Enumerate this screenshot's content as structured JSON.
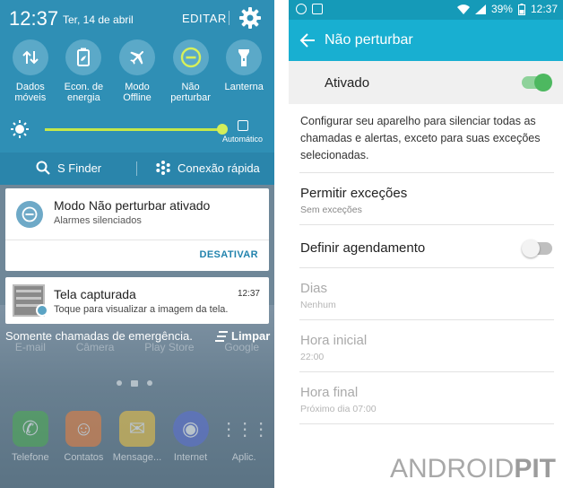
{
  "left": {
    "clock": "12:37",
    "date": "Ter, 14 de abril",
    "edit_label": "EDITAR",
    "quick_settings": [
      {
        "label": "Dados\nmóveis",
        "icon": "mobile-data-icon"
      },
      {
        "label": "Econ. de\nenergia",
        "icon": "battery-saver-icon"
      },
      {
        "label": "Modo\nOffline",
        "icon": "airplane-icon"
      },
      {
        "label": "Não\nperturbar",
        "icon": "do-not-disturb-icon"
      },
      {
        "label": "Lanterna",
        "icon": "flashlight-icon"
      }
    ],
    "brightness": {
      "level": 0.9,
      "auto_label": "Automático"
    },
    "finder_label": "S Finder",
    "quick_connect_label": "Conexão rápida",
    "notification_dnd": {
      "title": "Modo Não perturbar ativado",
      "subtitle": "Alarmes silenciados",
      "action": "DESATIVAR"
    },
    "notification_screenshot": {
      "title": "Tela capturada",
      "time": "12:37",
      "subtitle": "Toque para visualizar a imagem da tela."
    },
    "emergency_text": "Somente chamadas de emergência.",
    "clear_label": "Limpar",
    "home_apps_row": [
      "E-mail",
      "Câmera",
      "Play Store",
      "Google"
    ],
    "dock": [
      {
        "label": "Telefone",
        "icon": "phone-icon",
        "color": "#4caf50"
      },
      {
        "label": "Contatos",
        "icon": "contacts-icon",
        "color": "#f0813b"
      },
      {
        "label": "Mensage...",
        "icon": "messages-icon",
        "color": "#f5c842"
      },
      {
        "label": "Internet",
        "icon": "internet-icon",
        "color": "#5a6fd8"
      },
      {
        "label": "Aplic.",
        "icon": "apps-icon",
        "color": "#cfcfcf"
      }
    ]
  },
  "right": {
    "status": {
      "battery": "39%",
      "time": "12:37"
    },
    "title": "Não perturbar",
    "master": {
      "label": "Ativado",
      "on": true
    },
    "description": "Configurar seu aparelho para silenciar todas as chamadas e alertas, exceto para suas exceções selecionadas.",
    "exceptions": {
      "title": "Permitir exceções",
      "subtitle": "Sem exceções"
    },
    "schedule": {
      "title": "Definir agendamento",
      "on": false
    },
    "days": {
      "title": "Dias",
      "subtitle": "Nenhum"
    },
    "start": {
      "title": "Hora inicial",
      "subtitle": "22:00"
    },
    "end": {
      "title": "Hora final",
      "subtitle": "Próximo dia 07:00"
    }
  },
  "watermark": {
    "part1": "ANDROID",
    "part2": "PIT"
  },
  "colors": {
    "shade": "#2f8fb5",
    "tile": "#5ba9c8",
    "accent_blue": "#18afd1",
    "toggle_on": "#4db860",
    "slider": "#c5e84a"
  }
}
